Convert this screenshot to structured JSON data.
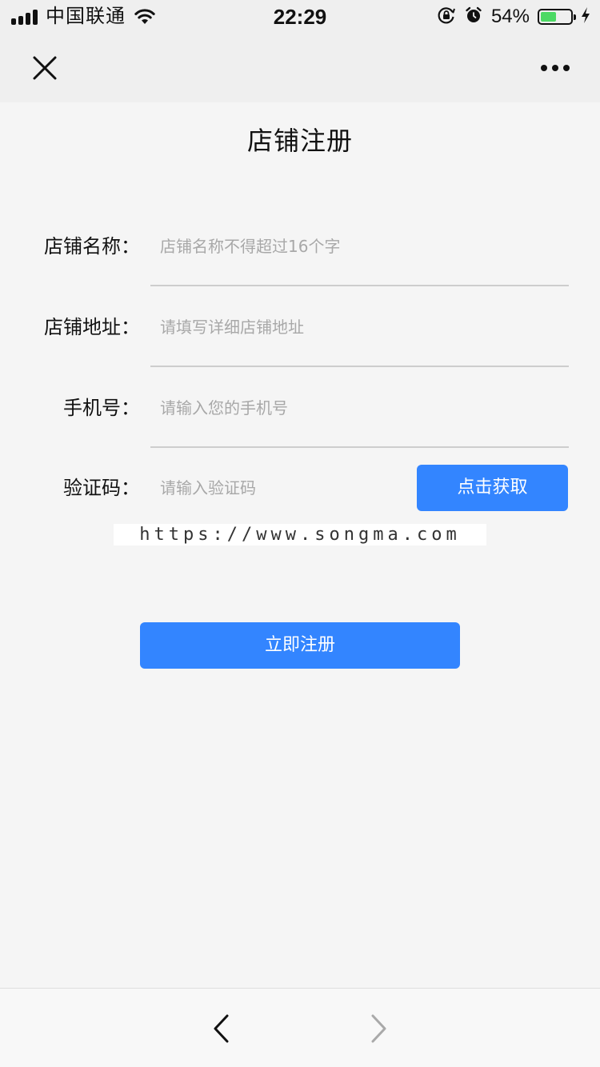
{
  "status_bar": {
    "carrier": "中国联通",
    "time": "22:29",
    "battery_percent": "54%",
    "battery_level": 0.54,
    "battery_color": "#4cd964",
    "icons": [
      "signal-icon",
      "wifi-icon",
      "rotation-lock-icon",
      "alarm-icon",
      "battery-icon",
      "charging-icon"
    ]
  },
  "nav": {
    "close_icon": "close-icon",
    "more_icon": "more-icon"
  },
  "page": {
    "title": "店铺注册"
  },
  "form": {
    "store_name": {
      "label": "店铺名称：",
      "placeholder": "店铺名称不得超过16个字",
      "value": ""
    },
    "store_address": {
      "label": "店铺地址：",
      "placeholder": "请填写详细店铺地址",
      "value": ""
    },
    "phone": {
      "label": "手机号：",
      "placeholder": "请输入您的手机号",
      "value": ""
    },
    "code": {
      "label": "验证码：",
      "placeholder": "请输入验证码",
      "value": "",
      "button_label": "点击获取"
    }
  },
  "watermark": {
    "text": "https://www.songma.com"
  },
  "actions": {
    "register_label": "立即注册",
    "accent_color": "#3385ff"
  },
  "toolbar": {
    "back_icon": "back-icon",
    "forward_icon": "forward-icon"
  }
}
